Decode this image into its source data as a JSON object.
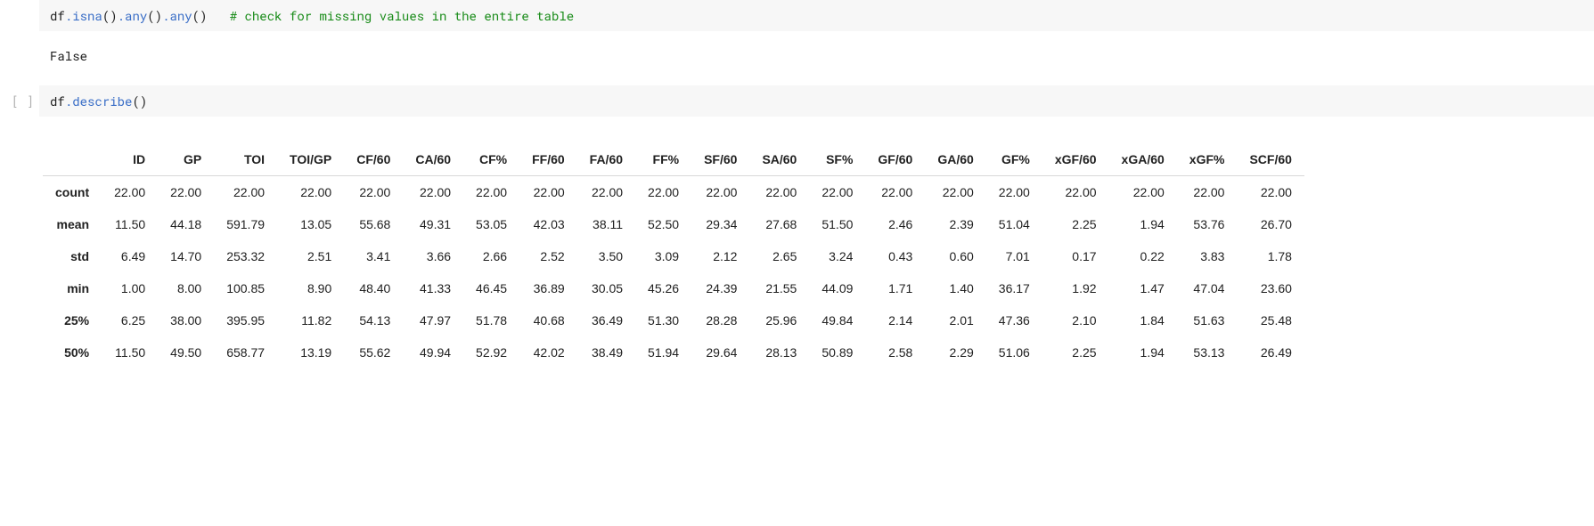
{
  "cell1": {
    "gutter": "",
    "code_plain": "df",
    "code_call1": ".isna",
    "code_paren1": "()",
    "code_call2": ".any",
    "code_paren2": "()",
    "code_call3": ".any",
    "code_paren3": "()",
    "code_spacer": "   ",
    "code_comment": "# check for missing values in the entire table",
    "output": "False"
  },
  "cell2": {
    "gutter": "[ ]",
    "code_plain": "df",
    "code_call1": ".describe",
    "code_paren1": "()"
  },
  "chart_data": {
    "type": "table",
    "columns": [
      "ID",
      "GP",
      "TOI",
      "TOI/GP",
      "CF/60",
      "CA/60",
      "CF%",
      "FF/60",
      "FA/60",
      "FF%",
      "SF/60",
      "SA/60",
      "SF%",
      "GF/60",
      "GA/60",
      "GF%",
      "xGF/60",
      "xGA/60",
      "xGF%",
      "SCF/60"
    ],
    "index": [
      "count",
      "mean",
      "std",
      "min",
      "25%",
      "50%"
    ],
    "rows": [
      [
        "22.00",
        "22.00",
        "22.00",
        "22.00",
        "22.00",
        "22.00",
        "22.00",
        "22.00",
        "22.00",
        "22.00",
        "22.00",
        "22.00",
        "22.00",
        "22.00",
        "22.00",
        "22.00",
        "22.00",
        "22.00",
        "22.00",
        "22.00"
      ],
      [
        "11.50",
        "44.18",
        "591.79",
        "13.05",
        "55.68",
        "49.31",
        "53.05",
        "42.03",
        "38.11",
        "52.50",
        "29.34",
        "27.68",
        "51.50",
        "2.46",
        "2.39",
        "51.04",
        "2.25",
        "1.94",
        "53.76",
        "26.70"
      ],
      [
        "6.49",
        "14.70",
        "253.32",
        "2.51",
        "3.41",
        "3.66",
        "2.66",
        "2.52",
        "3.50",
        "3.09",
        "2.12",
        "2.65",
        "3.24",
        "0.43",
        "0.60",
        "7.01",
        "0.17",
        "0.22",
        "3.83",
        "1.78"
      ],
      [
        "1.00",
        "8.00",
        "100.85",
        "8.90",
        "48.40",
        "41.33",
        "46.45",
        "36.89",
        "30.05",
        "45.26",
        "24.39",
        "21.55",
        "44.09",
        "1.71",
        "1.40",
        "36.17",
        "1.92",
        "1.47",
        "47.04",
        "23.60"
      ],
      [
        "6.25",
        "38.00",
        "395.95",
        "11.82",
        "54.13",
        "47.97",
        "51.78",
        "40.68",
        "36.49",
        "51.30",
        "28.28",
        "25.96",
        "49.84",
        "2.14",
        "2.01",
        "47.36",
        "2.10",
        "1.84",
        "51.63",
        "25.48"
      ],
      [
        "11.50",
        "49.50",
        "658.77",
        "13.19",
        "55.62",
        "49.94",
        "52.92",
        "42.02",
        "38.49",
        "51.94",
        "29.64",
        "28.13",
        "50.89",
        "2.58",
        "2.29",
        "51.06",
        "2.25",
        "1.94",
        "53.13",
        "26.49"
      ]
    ]
  }
}
